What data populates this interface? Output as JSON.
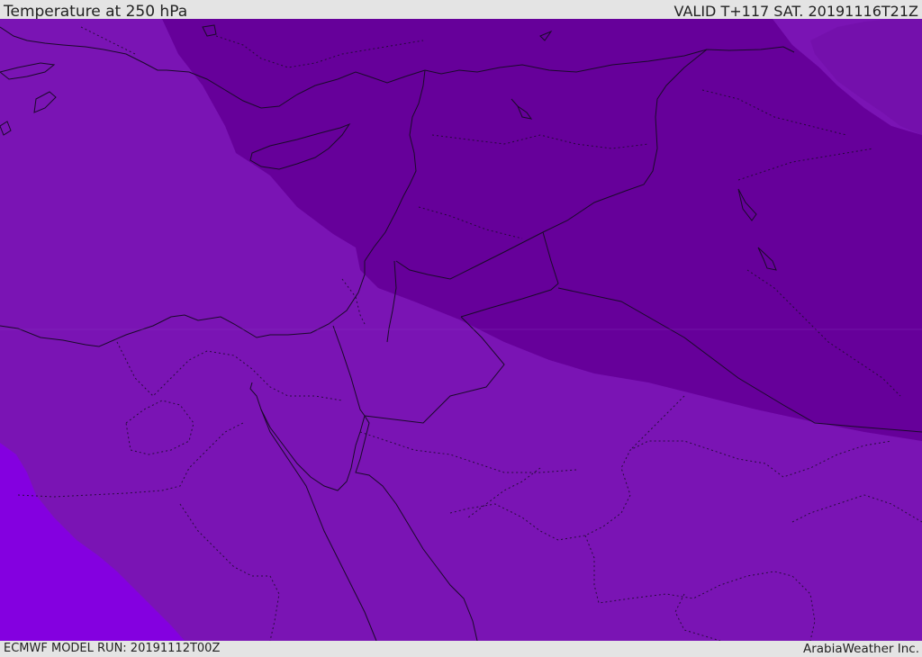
{
  "header": {
    "title": "Temperature at 250 hPa",
    "valid_time": "VALID T+117 SAT. 20191116T21Z"
  },
  "footer": {
    "model_run": "ECMWF MODEL RUN: 20191112T00Z",
    "credit": "ArabiaWeather Inc."
  },
  "map": {
    "colors": {
      "band_cold": "#66009a",
      "band_mid": "#7a14b4",
      "band_warm": "#8400e0",
      "coastline": "#1a0a2a"
    }
  }
}
